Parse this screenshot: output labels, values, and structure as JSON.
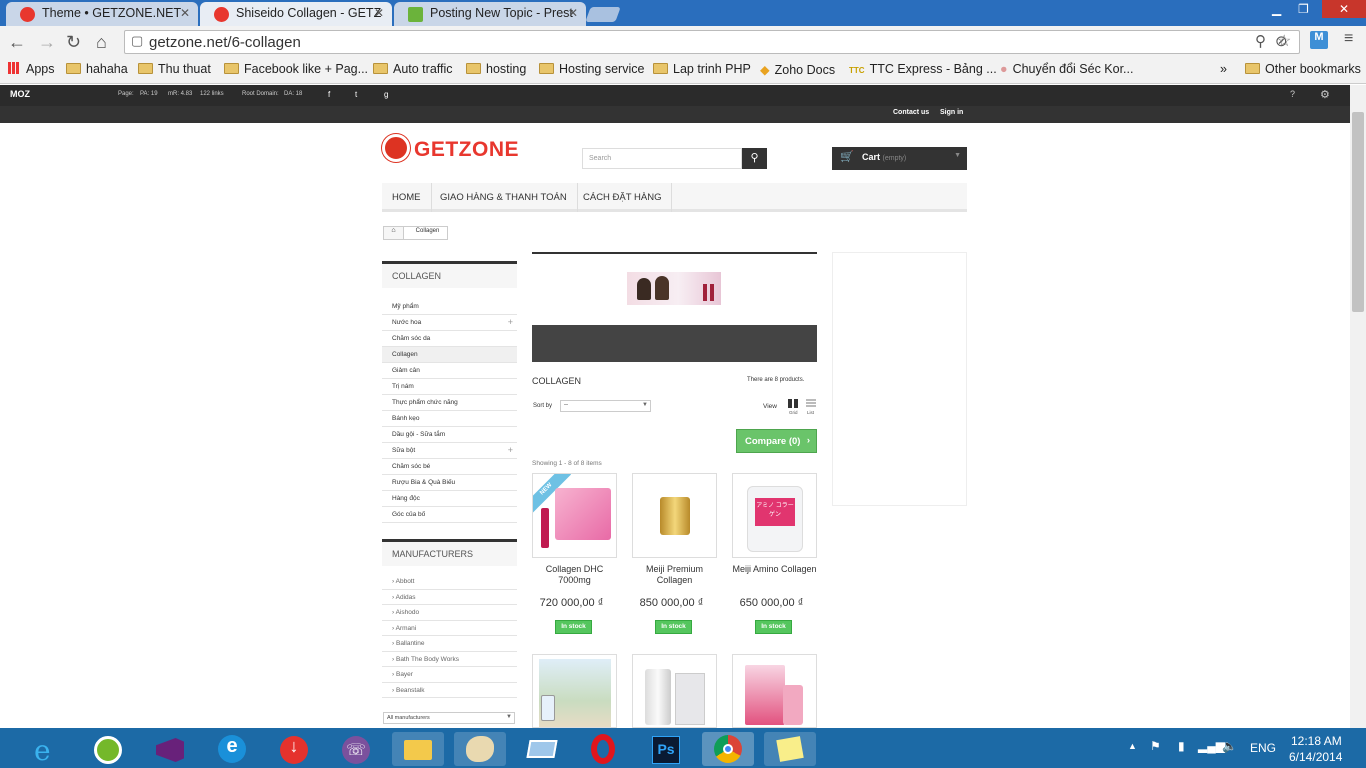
{
  "browser": {
    "tabs": [
      {
        "title": "Theme • GETZONE.NET",
        "active": false
      },
      {
        "title": "Shiseido Collagen - GETZ",
        "active": true
      },
      {
        "title": "Posting New Topic - Prest",
        "active": false
      }
    ],
    "url": "getzone.net/6-collagen",
    "bookmarks": [
      "Apps",
      "hahaha",
      "Thu thuat",
      "Facebook like + Pag...",
      "Auto traffic",
      "hosting",
      "Hosting service",
      "Lap trinh PHP",
      "Zoho Docs",
      "TTC Express - Bảng ...",
      "Chuyển đổi Séc Kor...",
      "»",
      "Other bookmarks"
    ]
  },
  "mozbar": {
    "logo": "MOZ",
    "page": "Page:",
    "pa": "PA: 19",
    "mr": "mR: 4.83",
    "links": "122 links",
    "root": "Root Domain:",
    "da": "DA: 18"
  },
  "site": {
    "header_links": [
      "Contact us",
      "Sign in"
    ],
    "logo": "GETZONE",
    "search_placeholder": "Search",
    "cart_label": "Cart",
    "cart_empty": "(empty)",
    "menu": [
      "HOME",
      "GIAO HÀNG & THANH TOÁN",
      "CÁCH ĐẶT HÀNG"
    ],
    "breadcrumb": "Collagen",
    "categories_title": "COLLAGEN",
    "categories": [
      "Mỹ phẩm",
      "Nước hoa",
      "Chăm sóc da",
      "Collagen",
      "Giảm cân",
      "Trị nám",
      "Thực phẩm chức năng",
      "Bánh kẹo",
      "Dầu gội - Sữa tắm",
      "Sữa bột",
      "Chăm sóc bé",
      "Rượu Bia & Quà Biếu",
      "Hàng độc",
      "Góc của bố"
    ],
    "manufacturers_title": "MANUFACTURERS",
    "manufacturers": [
      "Abbott",
      "Adidas",
      "Aishodo",
      "Armani",
      "Ballantine",
      "Bath The Body Works",
      "Bayer",
      "Beanstalk"
    ],
    "manufacturers_select": "All manufacturers",
    "page_title": "COLLAGEN",
    "product_count": "There are 8 products.",
    "sort_label": "Sort by",
    "sort_value": "--",
    "view_label": "View",
    "view_grid": "Grid",
    "view_list": "List",
    "compare": "Compare (0)",
    "showing": "Showing 1 - 8 of 8 items",
    "new_badge": "NEW",
    "products": [
      {
        "name": "Collagen DHC 7000mg",
        "price": "720 000,00 ₫",
        "stock": "In stock"
      },
      {
        "name": "Meiji Premium Collagen",
        "price": "850 000,00 ₫",
        "stock": "In stock"
      },
      {
        "name": "Meiji Amino Collagen",
        "price": "650 000,00 ₫",
        "stock": "In stock"
      }
    ],
    "amino_label": "アミノ コラーゲン"
  },
  "taskbar": {
    "lang": "ENG",
    "time": "12:18 AM",
    "date": "6/14/2014"
  }
}
